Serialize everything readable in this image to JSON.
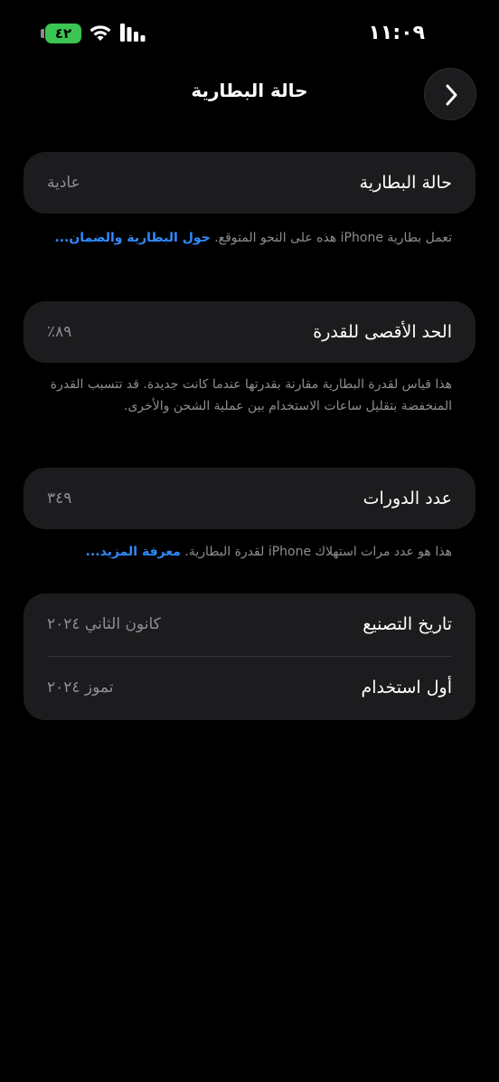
{
  "status_bar": {
    "time": "١١:٠٩",
    "battery_level": "٤٢",
    "battery_color": "#3bc552"
  },
  "nav": {
    "title": "حالة البطارية",
    "back_icon": "chevron-right-icon"
  },
  "battery_condition": {
    "label": "حالة البطارية",
    "value": "عادية",
    "note": "تعمل بطارية iPhone هذه على النحو المتوقع.",
    "link": "حول البطارية والضمان..."
  },
  "max_capacity": {
    "label": "الحد الأقصى للقدرة",
    "value": "٨٩٪",
    "note": "هذا قياس لقدرة البطارية مقارنة بقدرتها عندما كانت جديدة. قد تتسبب القدرة المنخفضة بتقليل ساعات الاستخدام بين عملية الشحن والأخرى."
  },
  "cycle_count": {
    "label": "عدد الدورات",
    "value": "٣٤٩",
    "note": "هذا هو عدد مرات استهلاك iPhone لقدرة البطارية.",
    "link": "معرفة المزيد..."
  },
  "dates": {
    "manufacture_label": "تاريخ التصنيع",
    "manufacture_value": "كانون الثاني ٢٠٢٤",
    "first_use_label": "أول استخدام",
    "first_use_value": "تموز ٢٠٢٤"
  },
  "colors": {
    "background": "#000000",
    "card": "#1c1c1e",
    "secondary_text": "#8e8e93",
    "link": "#2f8bff"
  }
}
